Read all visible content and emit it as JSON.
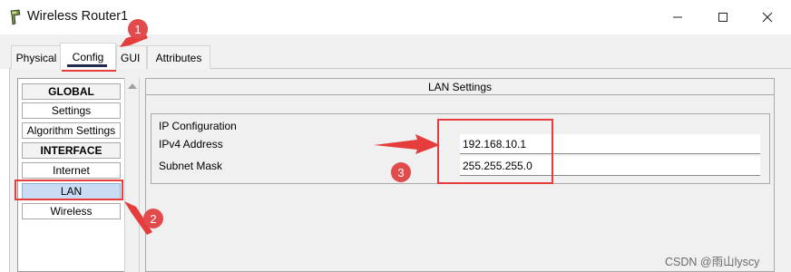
{
  "window": {
    "title": "Wireless Router1",
    "icon": "router-icon"
  },
  "tabs": [
    {
      "label": "Physical"
    },
    {
      "label": "Config",
      "selected": true
    },
    {
      "label": "GUI"
    },
    {
      "label": "Attributes"
    }
  ],
  "sidebar": {
    "items": [
      {
        "label": "GLOBAL",
        "type": "header"
      },
      {
        "label": "Settings"
      },
      {
        "label": "Algorithm Settings"
      },
      {
        "label": "INTERFACE",
        "type": "header"
      },
      {
        "label": "Internet"
      },
      {
        "label": "LAN",
        "selected": true
      },
      {
        "label": "Wireless"
      }
    ]
  },
  "panel": {
    "title": "LAN Settings",
    "group_title": "IP Configuration",
    "ipv4_label": "IPv4 Address",
    "ipv4_value": "192.168.10.1",
    "mask_label": "Subnet Mask",
    "mask_value": "255.255.255.0"
  },
  "annotations": {
    "badges": [
      "1",
      "2",
      "3"
    ],
    "accent_color": "#e53c3c"
  },
  "watermark": "CSDN @雨山lyscy"
}
